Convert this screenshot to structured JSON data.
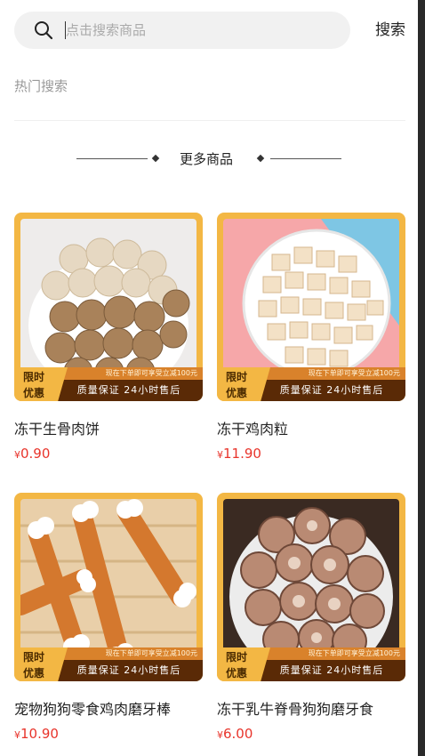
{
  "search": {
    "placeholder": "点击搜索商品",
    "button_label": "搜索"
  },
  "hot_search": {
    "label": "热门搜索"
  },
  "section": {
    "more_label": "更多商品"
  },
  "promo": {
    "tag_line1": "限时",
    "tag_line2": "优惠",
    "top_text": "现在下单即可享受立减100元",
    "bottom_text": "质量保证 24小时售后"
  },
  "currency_symbol": "¥",
  "products": [
    {
      "name": "冻干生骨肉饼",
      "price": "0.90",
      "image": "bone-meat-patties"
    },
    {
      "name": "冻干鸡肉粒",
      "price": "11.90",
      "image": "chicken-cubes"
    },
    {
      "name": "宠物狗狗零食鸡肉磨牙棒",
      "price": "10.90",
      "image": "chicken-dental-sticks"
    },
    {
      "name": "冻干乳牛脊骨狗狗磨牙食",
      "price": "6.00",
      "image": "beef-spine-chews"
    }
  ]
}
